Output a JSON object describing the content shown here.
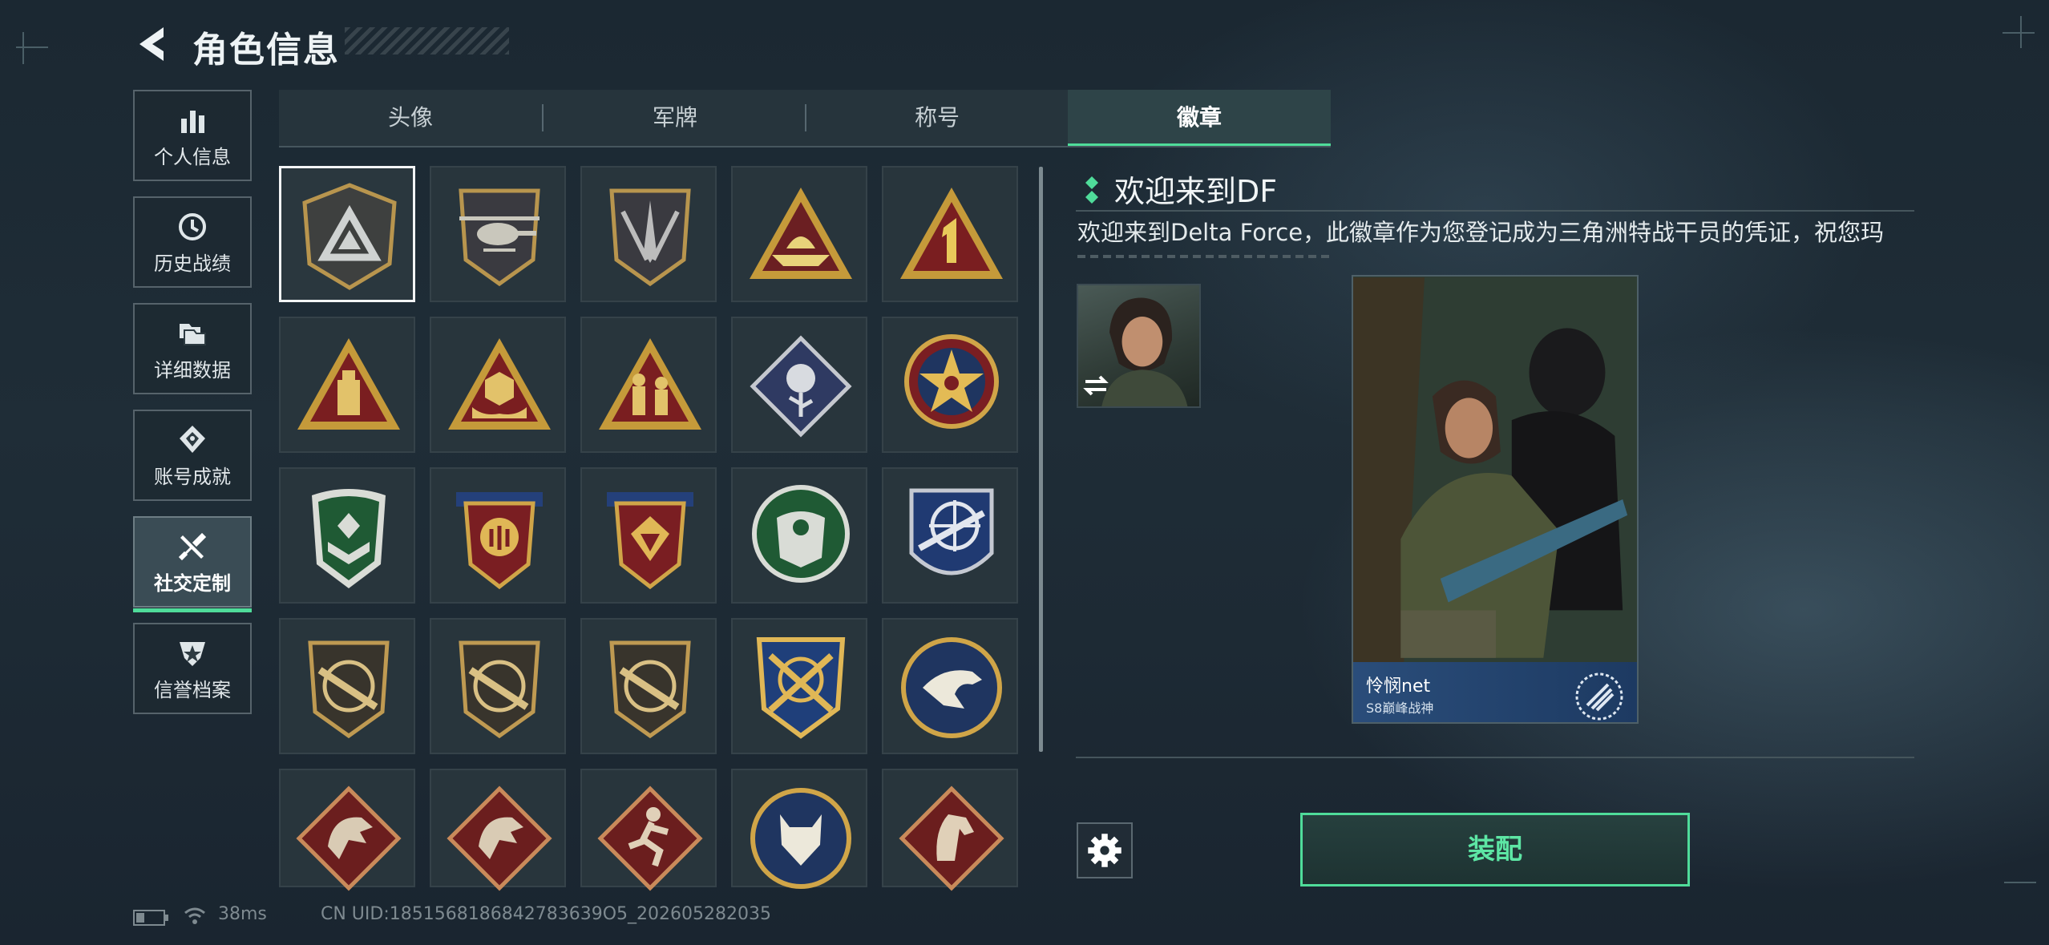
{
  "header": {
    "title": "角色信息"
  },
  "sidebar": {
    "items": [
      {
        "label": "个人信息",
        "icon": "bar-chart-icon"
      },
      {
        "label": "历史战绩",
        "icon": "history-icon"
      },
      {
        "label": "详细数据",
        "icon": "folders-icon"
      },
      {
        "label": "账号成就",
        "icon": "medal-icon"
      },
      {
        "label": "社交定制",
        "icon": "tools-icon",
        "active": true
      },
      {
        "label": "信誉档案",
        "icon": "shield-star-icon"
      }
    ]
  },
  "tabs": [
    {
      "label": "头像"
    },
    {
      "label": "军牌"
    },
    {
      "label": "称号"
    },
    {
      "label": "徽章",
      "active": true
    }
  ],
  "badges": [
    "triangle-emblem-icon",
    "helicopter-emblem-icon",
    "dagger-shield-icon",
    "boat-triangle-icon",
    "number-one-triangle-icon",
    "usb-triangle-icon",
    "dice-hands-triangle-icon",
    "soldiers-triangle-icon",
    "rose-diamond-icon",
    "star-circle-icon",
    "green-rank-shield-icon",
    "red-rank-shield-icon",
    "red-gem-shield-icon",
    "green-armor-circle-icon",
    "blue-sniper-shield-icon",
    "rifle-shield-icon",
    "rifle-shield-icon",
    "rifle-shield-icon",
    "crossed-rifle-crest-icon",
    "eagle-circle-icon",
    "dragon-diamond-icon",
    "dragon-diamond-icon",
    "runner-diamond-icon",
    "wolf-circle-icon",
    "horse-diamond-icon"
  ],
  "selected_badge": {
    "title": "欢迎来到DF",
    "description": "欢迎来到Delta Force，此徽章作为您登记成为三角洲特战干员的凭证，祝您玛"
  },
  "preview_card": {
    "name": "怜悯net",
    "subtitle": "S8巅峰战神"
  },
  "actions": {
    "equip_label": "装配"
  },
  "status": {
    "ping": "38ms",
    "uid": "CN UID:1851568186842783639O5_202605282035"
  },
  "colors": {
    "accent": "#4fdc9a",
    "background": "#1f2d37"
  }
}
